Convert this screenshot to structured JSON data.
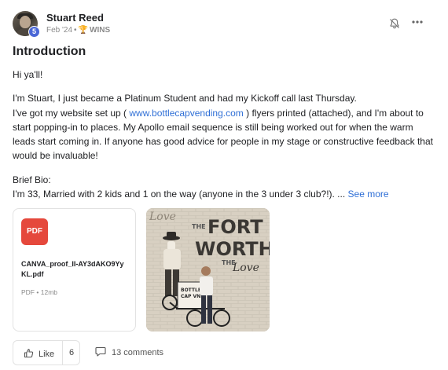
{
  "post": {
    "author": {
      "name": "Stuart Reed",
      "level": "5"
    },
    "meta": {
      "date": "Feb '24",
      "separator": "•",
      "category_icon": "trophy-icon",
      "category": "WINS"
    },
    "actions": {
      "bell_icon": "bell-icon",
      "more_icon": "more-horizontal-icon"
    },
    "title": "Introduction",
    "body": {
      "greeting": "Hi ya'll!",
      "line1": "I'm Stuart, I just became a Platinum Student and had my Kickoff call last Thursday.",
      "line2_before_link": "I've got my website set up ( ",
      "link_text": "www.bottlecapvending.com",
      "line2_after_link": " ) flyers printed (attached), and I'm about to start popping-in to places. My Apollo email sequence is still being worked out for when the warm leads start coming in. If anyone has good advice for people in my stage or constructive feedback that would be invaluable!",
      "bio_label": "Brief Bio:",
      "bio_text": "I'm 33, Married with 2 kids and 1 on the way (anyone in the 3 under 3 club?!). ... ",
      "see_more": "See more"
    },
    "attachments": {
      "pdf": {
        "badge": "PDF",
        "file_name": "CANVA_proof_II-AY3dAKO9YyKL.pdf",
        "file_type": "PDF",
        "separator": "•",
        "file_size": "12mb"
      },
      "image": {
        "text_love_top": "Love",
        "text_the": "THE",
        "text_fort": "FORT",
        "text_worth": "WORTH",
        "text_the2": "THE",
        "text_love_bottom": "Love",
        "cart_text_1": "BOTTLE",
        "cart_text_2": "CAP VND"
      }
    },
    "footer": {
      "like_label": "Like",
      "like_count": "6",
      "comments_label": "13 comments"
    }
  },
  "colors": {
    "link": "#2f6fd6",
    "pdf_badge": "#e5483c",
    "level_badge": "#4a67d6"
  }
}
